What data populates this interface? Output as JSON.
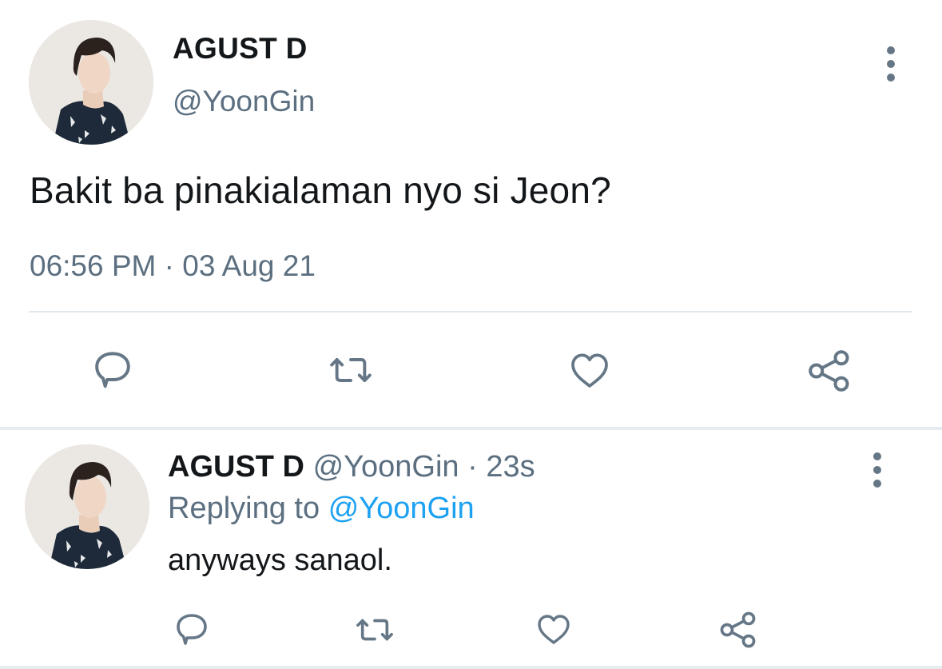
{
  "tweet": {
    "author_name": "AGUST D",
    "author_handle": "@YoonGin",
    "text": "Bakit ba pinakialaman nyo si Jeon?",
    "timestamp": "06:56 PM · 03 Aug 21",
    "icons": {
      "reply": "comment-icon",
      "retweet": "retweet-icon",
      "like": "heart-icon",
      "share": "share-icon",
      "more": "more-vertical-icon"
    }
  },
  "reply": {
    "author_name": "AGUST D",
    "author_handle": "@YoonGin",
    "separator": "·",
    "age": "23s",
    "replying_prefix": "Replying to",
    "replying_to": "@YoonGin",
    "text": "anyways sanaol."
  },
  "colors": {
    "text": "#14171a",
    "secondary": "#5b6f80",
    "icon": "#657786",
    "link": "#1da1f2",
    "divider": "#e1e8ed"
  }
}
